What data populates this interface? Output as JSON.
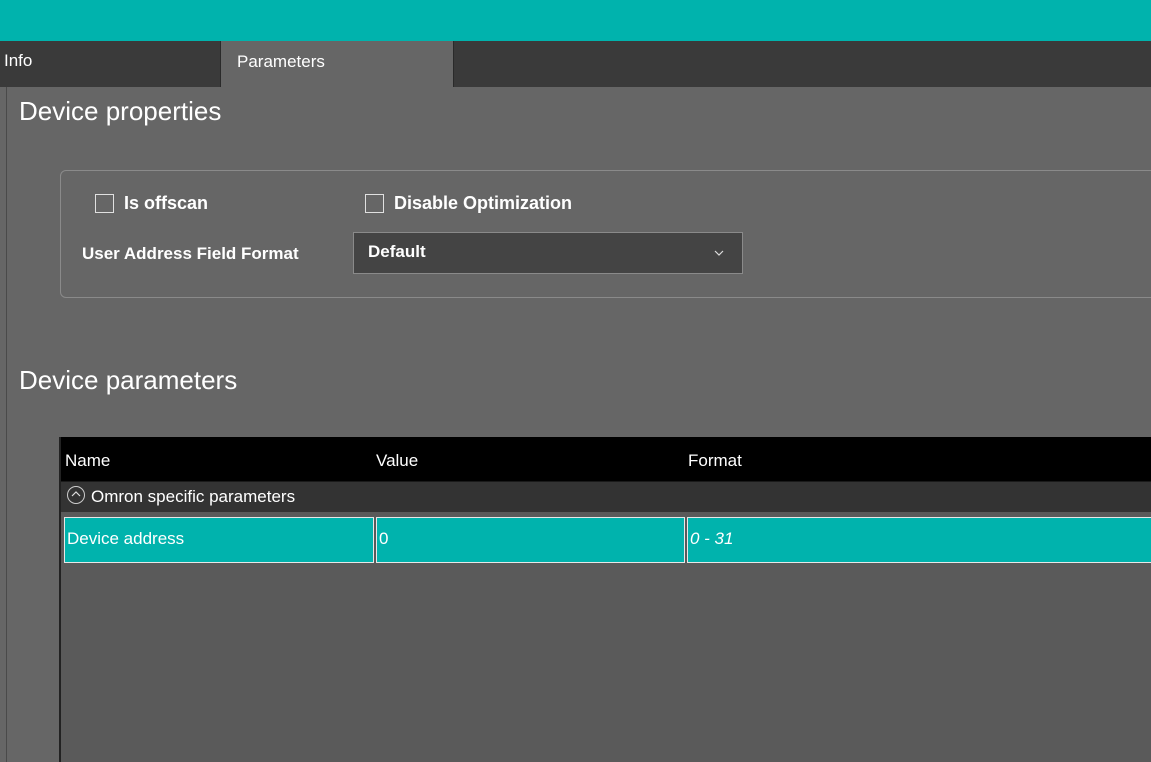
{
  "tabs": [
    {
      "label": "Info"
    },
    {
      "label": "Parameters"
    }
  ],
  "device_properties": {
    "title": "Device properties",
    "checkbox_offscan": "Is offscan",
    "checkbox_optimization": "Disable Optimization",
    "field_label": "User Address Field Format",
    "field_value": "Default"
  },
  "device_parameters": {
    "title": "Device parameters",
    "columns": [
      "Name",
      "Value",
      "Format"
    ],
    "group_label": "Omron specific parameters",
    "rows": [
      {
        "name": "Device address",
        "value": "0",
        "format": "0 - 31"
      }
    ]
  },
  "colors": {
    "accent": "#00b3ad",
    "background": "#666666",
    "header_bg": "#000000"
  },
  "icons": {
    "dropdown": "chevron-down-icon",
    "group_toggle": "collapse-circle-icon"
  }
}
